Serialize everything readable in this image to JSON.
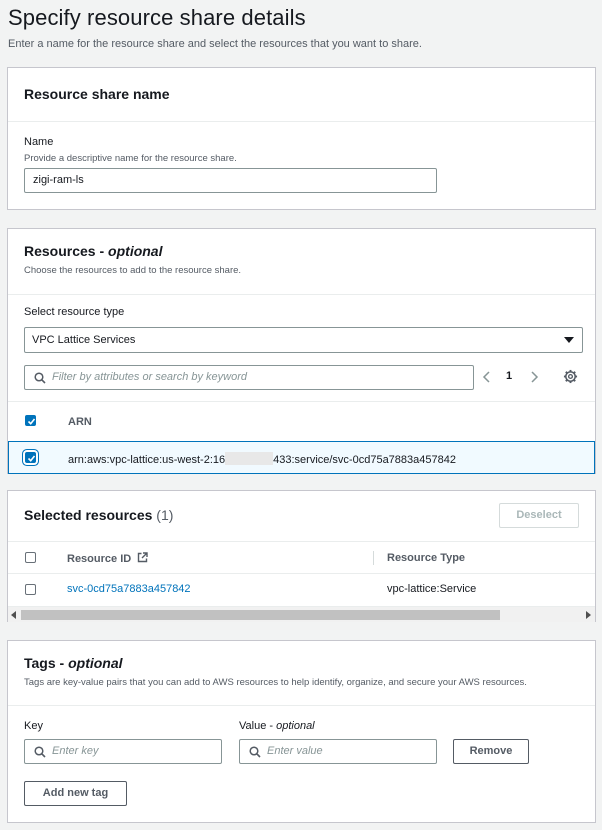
{
  "page": {
    "title": "Specify resource share details",
    "subtitle": "Enter a name for the resource share and select the resources that you want to share."
  },
  "name_section": {
    "heading": "Resource share name",
    "field_label": "Name",
    "field_desc": "Provide a descriptive name for the resource share.",
    "value": "zigi-ram-ls"
  },
  "resources_section": {
    "heading": "Resources",
    "heading_dash": " - ",
    "heading_optional": "optional",
    "desc": "Choose the resources to add to the resource share.",
    "type_label": "Select resource type",
    "type_value": "VPC Lattice Services",
    "filter_placeholder": "Filter by attributes or search by keyword",
    "page_number": "1",
    "column_arn": "ARN",
    "row_arn_prefix": "arn:aws:vpc-lattice:us-west-2:16",
    "row_arn_suffix": "433:service/svc-0cd75a7883a457842"
  },
  "selected_section": {
    "heading": "Selected resources",
    "count": "(1)",
    "deselect_label": "Deselect",
    "col_resource_id": "Resource ID",
    "col_resource_type": "Resource Type",
    "row_id": "svc-0cd75a7883a457842",
    "row_type": "vpc-lattice:Service"
  },
  "tags_section": {
    "heading": "Tags",
    "heading_dash": " - ",
    "heading_optional": "optional",
    "desc": "Tags are key-value pairs that you can add to AWS resources to help identify, organize, and secure your AWS resources.",
    "key_label": "Key",
    "value_label": "Value - ",
    "value_label_optional": "optional",
    "key_placeholder": "Enter key",
    "value_placeholder": "Enter value",
    "remove_label": "Remove",
    "add_label": "Add new tag"
  },
  "colors": {
    "accent": "#0073bb",
    "selected_row_border": "#0073bb",
    "selected_row_bg": "#f1faff"
  }
}
